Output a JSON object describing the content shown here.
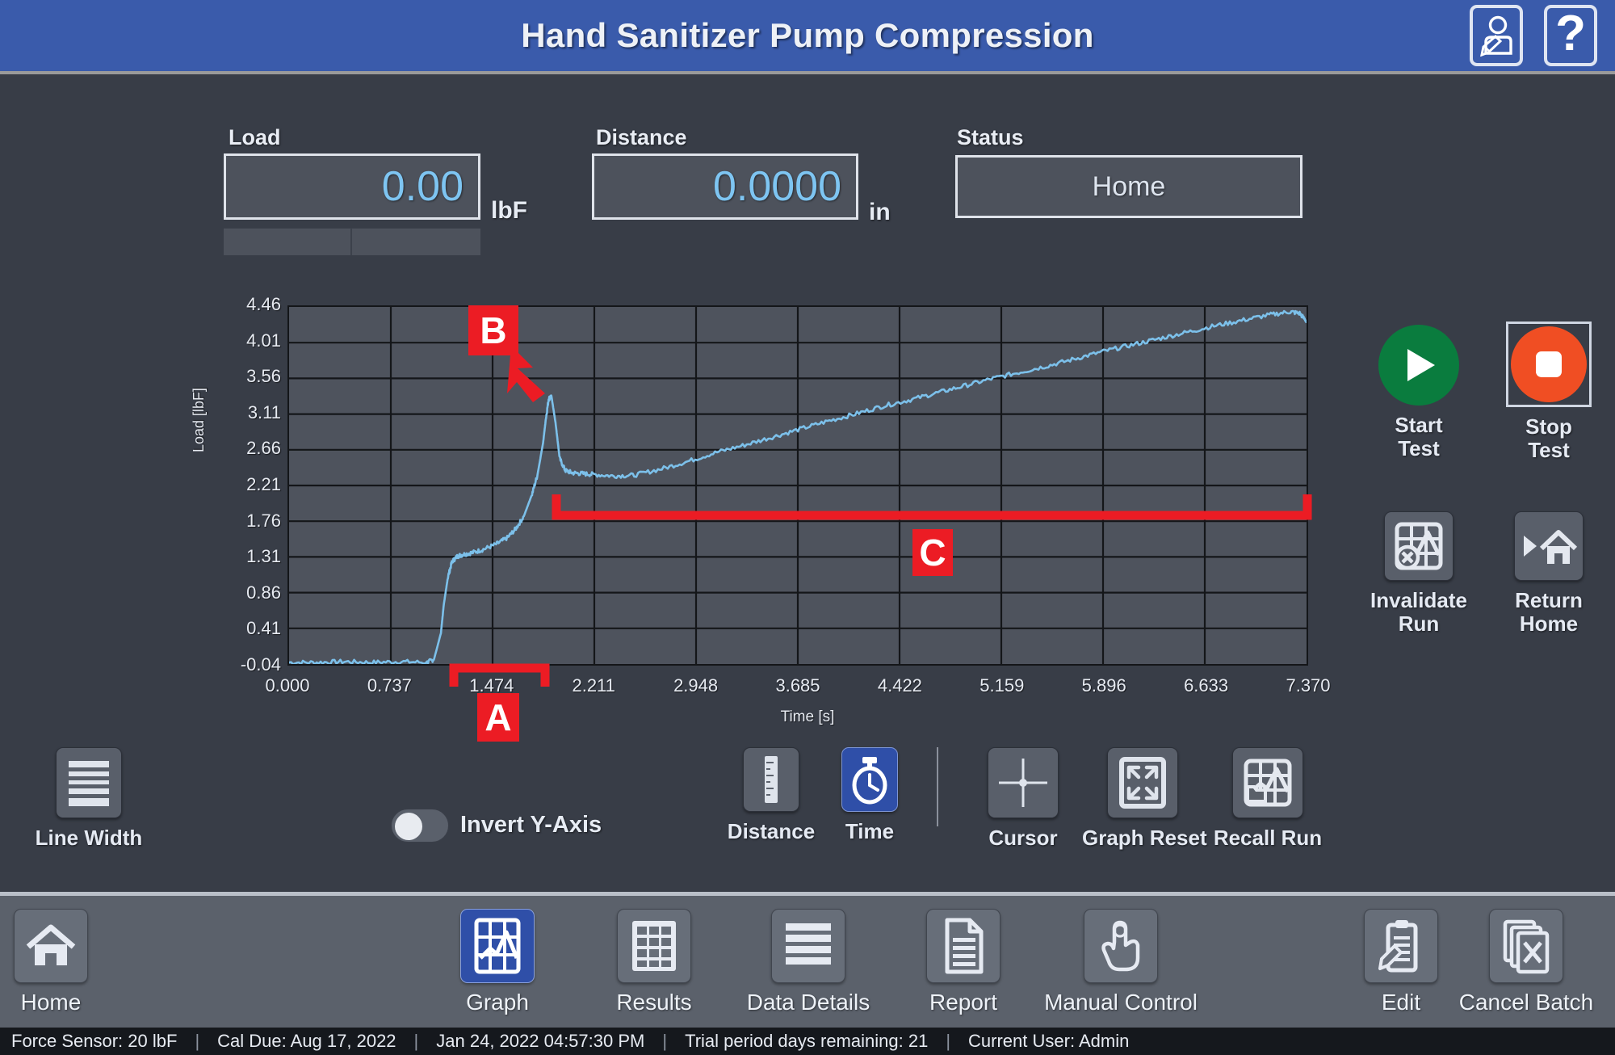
{
  "header": {
    "title": "Hand Sanitizer Pump Compression",
    "user_icon": "user-edit-icon",
    "help_icon": "question-mark-icon",
    "help_glyph": "?",
    "accent_color": "#3a5bab"
  },
  "readouts": {
    "load": {
      "label": "Load",
      "value": "0.00",
      "unit": "lbF"
    },
    "distance": {
      "label": "Distance",
      "value": "0.0000",
      "unit": "in"
    },
    "status": {
      "label": "Status",
      "value": "Home"
    }
  },
  "chart_data": {
    "type": "line",
    "title": "",
    "xlabel": "Time [s]",
    "ylabel": "Load [lbF]",
    "grid": true,
    "legend": "none",
    "line_color": "#7cc0ea",
    "xlim": [
      0.0,
      7.37
    ],
    "ylim": [
      -0.04,
      4.46
    ],
    "xticks": [
      "0.000",
      "0.737",
      "1.474",
      "2.211",
      "2.948",
      "3.685",
      "4.422",
      "5.159",
      "5.896",
      "6.633",
      "7.370"
    ],
    "yticks": [
      "4.46",
      "4.01",
      "3.56",
      "3.11",
      "2.66",
      "2.21",
      "1.76",
      "1.31",
      "0.86",
      "0.41",
      "-0.04"
    ],
    "series": [
      {
        "name": "Load",
        "x": [
          0.0,
          0.2,
          0.4,
          0.6,
          0.8,
          1.0,
          1.05,
          1.1,
          1.12,
          1.15,
          1.18,
          1.22,
          1.26,
          1.32,
          1.4,
          1.5,
          1.58,
          1.64,
          1.7,
          1.76,
          1.8,
          1.84,
          1.86,
          1.88,
          1.9,
          1.93,
          1.96,
          2.0,
          2.05,
          2.12,
          2.2,
          2.35,
          2.5,
          2.7,
          2.9,
          3.1,
          3.3,
          3.5,
          3.7,
          3.9,
          4.1,
          4.3,
          4.5,
          4.7,
          4.9,
          5.1,
          5.3,
          5.5,
          5.7,
          5.9,
          6.1,
          6.3,
          6.5,
          6.7,
          6.9,
          7.1,
          7.25,
          7.32,
          7.37
        ],
        "y": [
          -0.02,
          -0.02,
          -0.01,
          -0.02,
          -0.01,
          -0.02,
          0.02,
          0.35,
          0.7,
          1.05,
          1.25,
          1.32,
          1.34,
          1.36,
          1.4,
          1.47,
          1.55,
          1.66,
          1.82,
          2.1,
          2.35,
          2.75,
          3.05,
          3.3,
          3.34,
          3.0,
          2.55,
          2.4,
          2.37,
          2.36,
          2.35,
          2.33,
          2.34,
          2.42,
          2.52,
          2.63,
          2.72,
          2.82,
          2.92,
          3.02,
          3.11,
          3.21,
          3.29,
          3.38,
          3.47,
          3.56,
          3.64,
          3.72,
          3.81,
          3.9,
          3.98,
          4.06,
          4.14,
          4.22,
          4.29,
          4.36,
          4.4,
          4.38,
          4.28
        ]
      }
    ],
    "annotations": [
      {
        "id": "A",
        "label": "A",
        "type": "bracket-below",
        "x_start": 1.18,
        "x_end": 1.85,
        "color": "#ec1c24"
      },
      {
        "id": "B",
        "label": "B",
        "type": "arrow-callout",
        "target_x": 1.88,
        "target_y": 3.34,
        "color": "#ec1c24"
      },
      {
        "id": "C",
        "label": "C",
        "type": "bracket-above",
        "x_start": 1.93,
        "x_end": 7.37,
        "color": "#ec1c24"
      }
    ]
  },
  "actions": [
    {
      "name": "start-test",
      "label_line1": "Start",
      "label_line2": "Test",
      "icon": "play-icon",
      "color": "#0a7c3e",
      "selected": false
    },
    {
      "name": "stop-test",
      "label_line1": "Stop",
      "label_line2": "Test",
      "icon": "stop-icon",
      "color": "#f04e23",
      "selected": true
    },
    {
      "name": "invalidate-run",
      "label_line1": "Invalidate",
      "label_line2": "Run",
      "icon": "chart-invalidate-icon",
      "selected": false
    },
    {
      "name": "return-home",
      "label_line1": "Return",
      "label_line2": "Home",
      "icon": "play-home-icon",
      "selected": false
    }
  ],
  "graph_tools": {
    "line_width": {
      "label": "Line Width",
      "icon": "line-width-icon"
    },
    "invert_y": {
      "label": "Invert Y-Axis",
      "state": "off"
    },
    "distance": {
      "label": "Distance",
      "icon": "ruler-icon",
      "selected": false
    },
    "time": {
      "label": "Time",
      "icon": "stopwatch-icon",
      "selected": true
    },
    "cursor": {
      "label": "Cursor",
      "icon": "crosshair-icon",
      "selected": false
    },
    "graph_reset": {
      "label": "Graph Reset",
      "icon": "expand-arrows-icon",
      "selected": false
    },
    "recall_run": {
      "label": "Recall Run",
      "icon": "chart-folder-icon",
      "selected": false
    }
  },
  "nav": [
    {
      "name": "home",
      "label": "Home",
      "icon": "home-icon",
      "selected": false
    },
    {
      "name": "graph",
      "label": "Graph",
      "icon": "chart-icon",
      "selected": true
    },
    {
      "name": "results",
      "label": "Results",
      "icon": "grid-table-icon",
      "selected": false
    },
    {
      "name": "data-details",
      "label": "Data Details",
      "icon": "lines-icon",
      "selected": false
    },
    {
      "name": "report",
      "label": "Report",
      "icon": "document-icon",
      "selected": false
    },
    {
      "name": "manual-control",
      "label": "Manual Control",
      "icon": "hand-pointer-icon",
      "selected": false
    },
    {
      "name": "edit",
      "label": "Edit",
      "icon": "clipboard-pencil-icon",
      "selected": false
    },
    {
      "name": "cancel-batch",
      "label": "Cancel Batch",
      "icon": "cancel-documents-icon",
      "selected": false
    }
  ],
  "statusbar": {
    "force_sensor": "Force Sensor: 20 lbF",
    "cal_due": "Cal Due: Aug 17, 2022",
    "datetime": "Jan 24, 2022 04:57:30 PM",
    "trial": "Trial period days remaining: 21",
    "user": "Current User: Admin",
    "sep": "|"
  }
}
